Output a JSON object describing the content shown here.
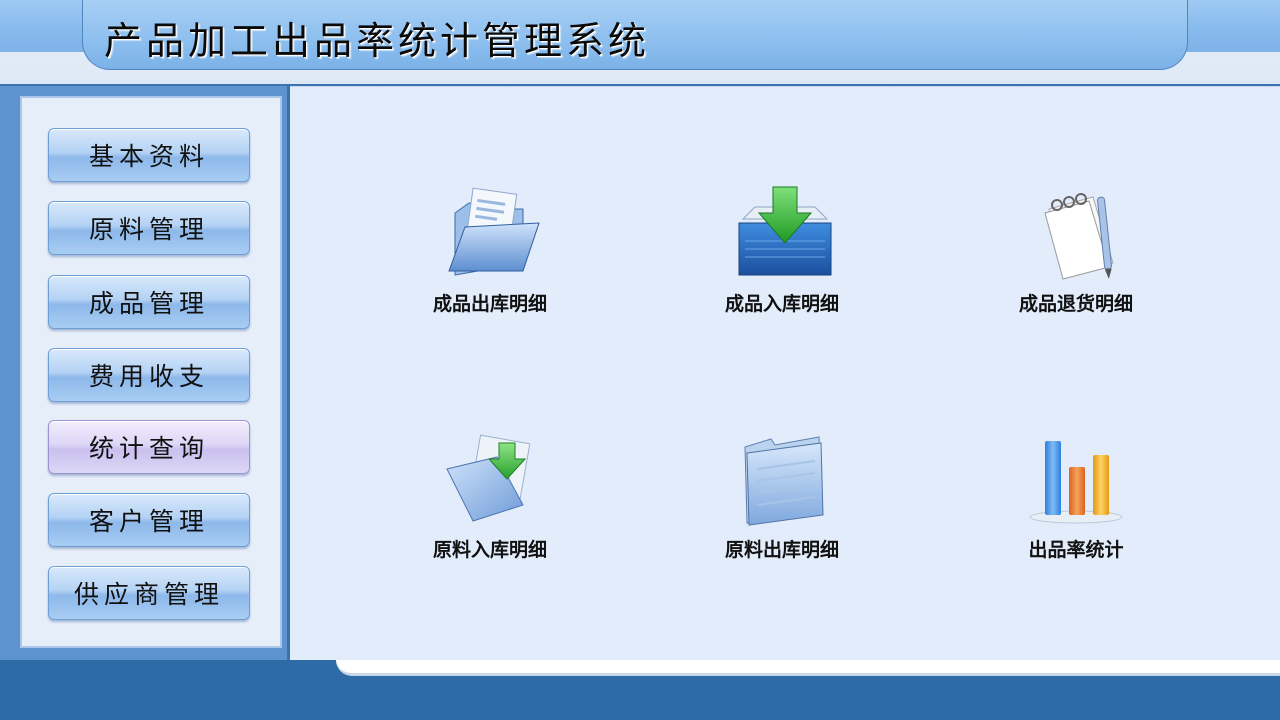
{
  "app": {
    "title": "产品加工出品率统计管理系统"
  },
  "sidebar": {
    "items": [
      {
        "label": "基本资料",
        "active": false
      },
      {
        "label": "原料管理",
        "active": false
      },
      {
        "label": "成品管理",
        "active": false
      },
      {
        "label": "费用收支",
        "active": false
      },
      {
        "label": "统计查询",
        "active": true
      },
      {
        "label": "客户管理",
        "active": false
      },
      {
        "label": "供应商管理",
        "active": false
      }
    ]
  },
  "main": {
    "tiles": [
      {
        "label": "成品出库明细",
        "icon": "open-folder-documents-icon"
      },
      {
        "label": "成品入库明细",
        "icon": "inbox-download-arrow-icon"
      },
      {
        "label": "成品退货明细",
        "icon": "notepad-pen-icon"
      },
      {
        "label": "原料入库明细",
        "icon": "documents-download-arrow-icon"
      },
      {
        "label": "原料出库明细",
        "icon": "blue-folder-icon"
      },
      {
        "label": "出品率统计",
        "icon": "bar-chart-icon"
      }
    ]
  },
  "colors": {
    "header_band": "#8fc0ef",
    "sidebar_frame": "#5d94cf",
    "main_bg": "#e2ecfa",
    "footer": "#2e6aa6",
    "active_button": "#ddd6f6"
  }
}
